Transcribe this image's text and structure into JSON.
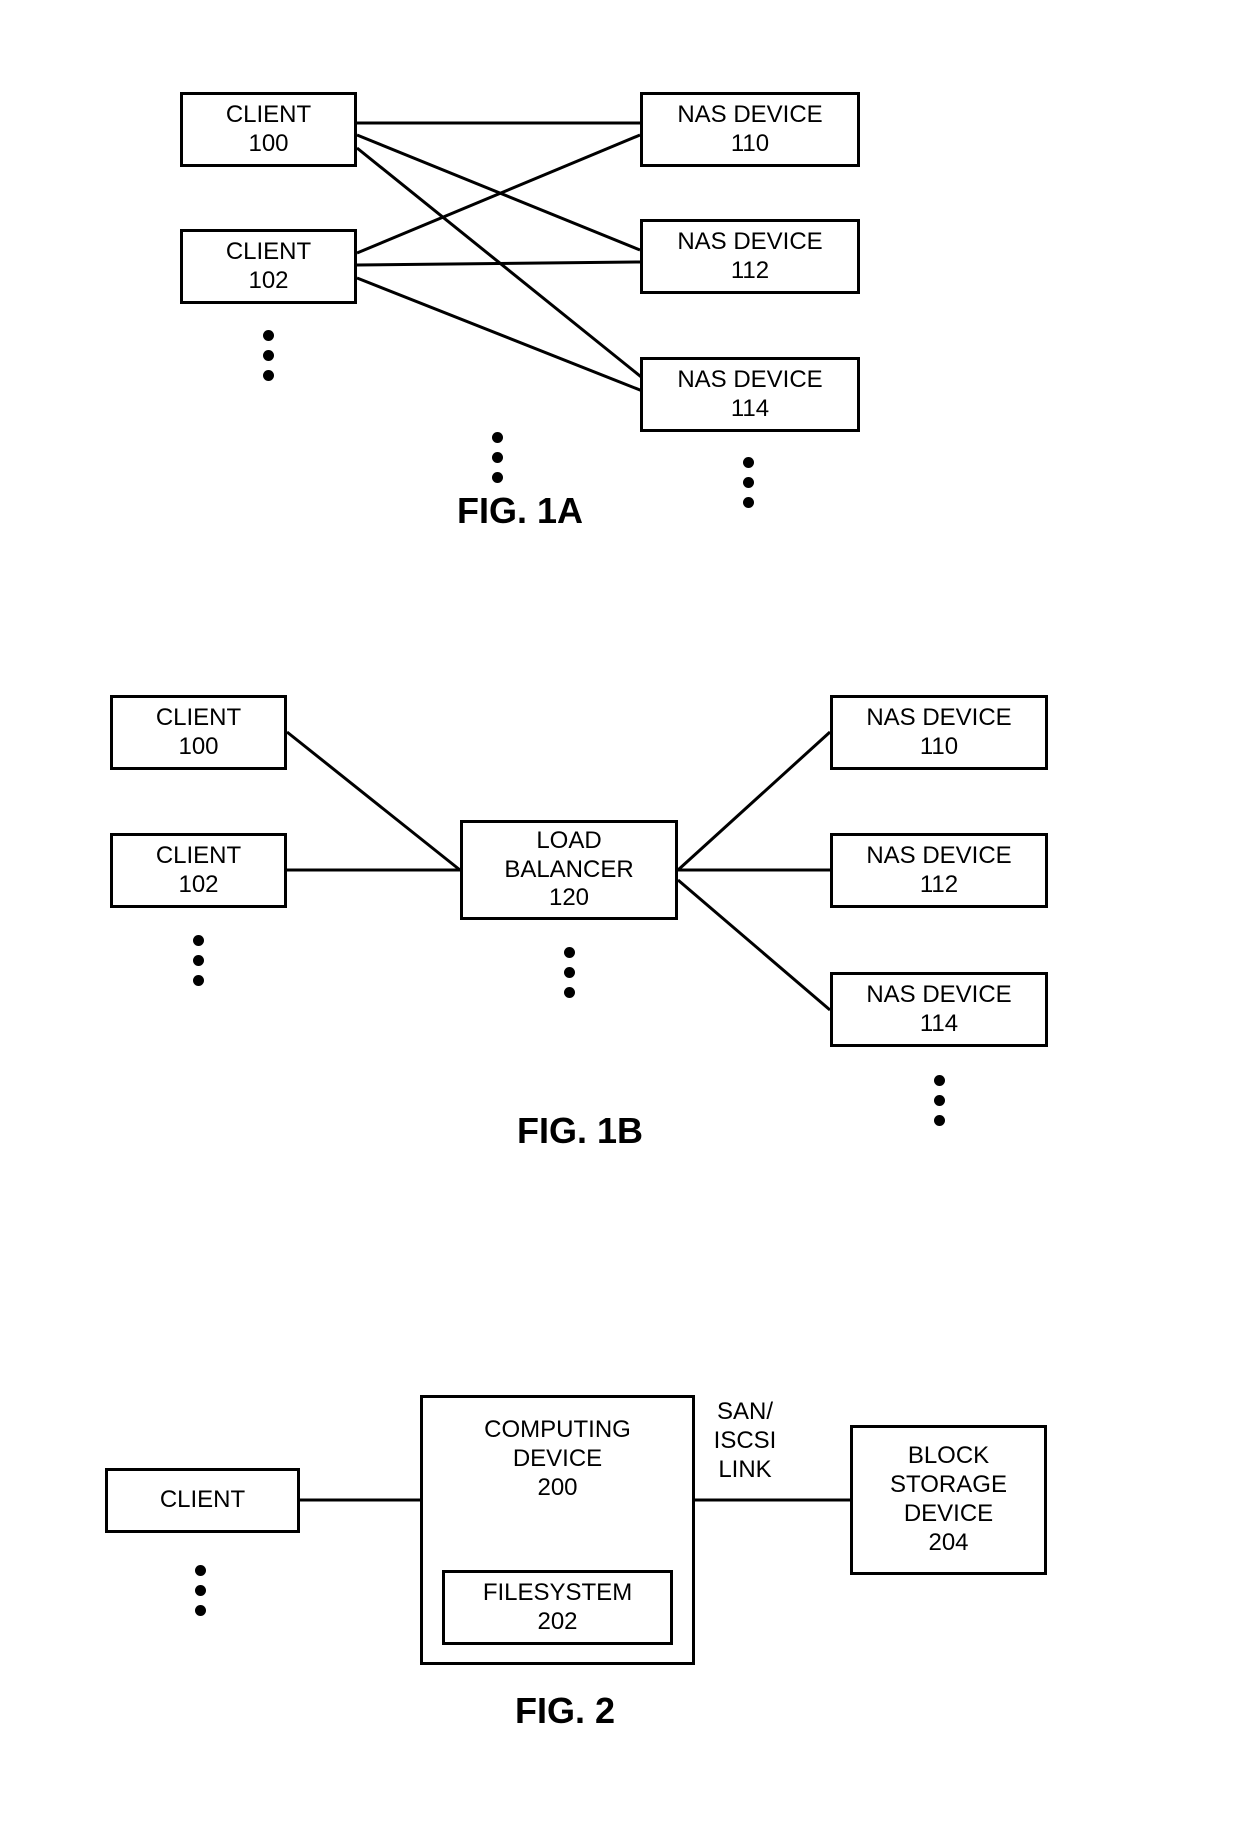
{
  "fig1a": {
    "caption": "FIG. 1A",
    "client100": {
      "l1": "CLIENT",
      "l2": "100"
    },
    "client102": {
      "l1": "CLIENT",
      "l2": "102"
    },
    "nas110": {
      "l1": "NAS DEVICE",
      "l2": "110"
    },
    "nas112": {
      "l1": "NAS DEVICE",
      "l2": "112"
    },
    "nas114": {
      "l1": "NAS DEVICE",
      "l2": "114"
    }
  },
  "fig1b": {
    "caption": "FIG. 1B",
    "client100": {
      "l1": "CLIENT",
      "l2": "100"
    },
    "client102": {
      "l1": "CLIENT",
      "l2": "102"
    },
    "lb120": {
      "l1": "LOAD",
      "l2": "BALANCER",
      "l3": "120"
    },
    "nas110": {
      "l1": "NAS DEVICE",
      "l2": "110"
    },
    "nas112": {
      "l1": "NAS DEVICE",
      "l2": "112"
    },
    "nas114": {
      "l1": "NAS DEVICE",
      "l2": "114"
    }
  },
  "fig2": {
    "caption": "FIG. 2",
    "client": {
      "l1": "CLIENT"
    },
    "comp200": {
      "l1": "COMPUTING",
      "l2": "DEVICE",
      "l3": "200"
    },
    "fs202": {
      "l1": "FILESYSTEM",
      "l2": "202"
    },
    "link": {
      "l1": "SAN/",
      "l2": "ISCSI",
      "l3": "LINK"
    },
    "block204": {
      "l1": "BLOCK",
      "l2": "STORAGE",
      "l3": "DEVICE",
      "l4": "204"
    }
  }
}
